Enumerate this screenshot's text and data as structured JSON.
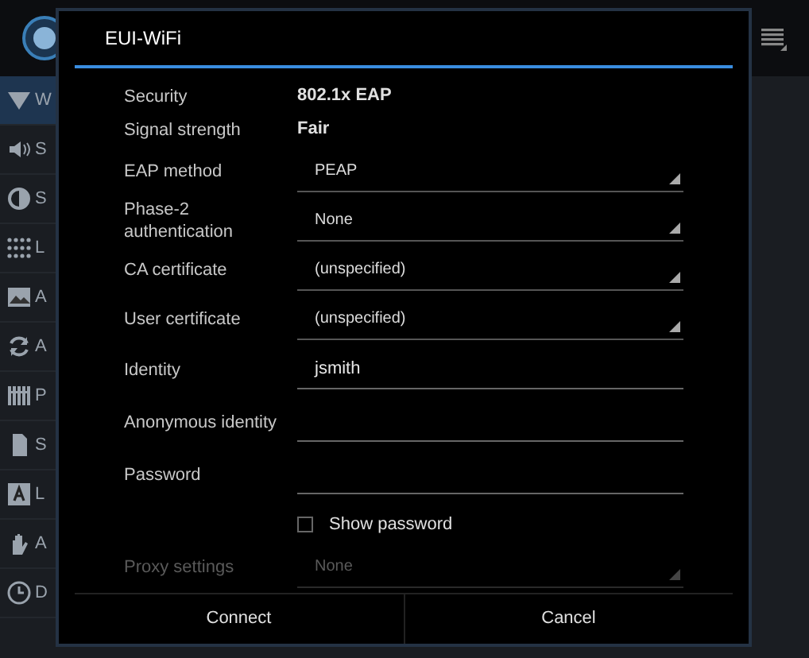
{
  "sidebar": {
    "items": [
      {
        "kind": "wifi",
        "label": "W",
        "selected": true
      },
      {
        "kind": "sound",
        "label": "S",
        "selected": false
      },
      {
        "kind": "brightness",
        "label": "S",
        "selected": false
      },
      {
        "kind": "grid",
        "label": "L",
        "selected": false
      },
      {
        "kind": "image",
        "label": "A",
        "selected": false
      },
      {
        "kind": "sync",
        "label": "A",
        "selected": false
      },
      {
        "kind": "bars",
        "label": "P",
        "selected": false
      },
      {
        "kind": "card",
        "label": "S",
        "selected": false
      },
      {
        "kind": "letter",
        "label": "L",
        "selected": false
      },
      {
        "kind": "hand",
        "label": "A",
        "selected": false
      },
      {
        "kind": "clock",
        "label": "D",
        "selected": false
      }
    ]
  },
  "dialog": {
    "title": "EUI-WiFi",
    "rows": [
      {
        "kind": "info",
        "label": "Security",
        "value": "802.1x EAP"
      },
      {
        "kind": "info",
        "label": "Signal strength",
        "value": "Fair"
      },
      {
        "kind": "spinner",
        "label": "EAP method",
        "value": "PEAP"
      },
      {
        "kind": "spinner",
        "label": "Phase-2 authentication",
        "value": "None"
      },
      {
        "kind": "spinner",
        "label": "CA certificate",
        "value": "(unspecified)"
      },
      {
        "kind": "spinner",
        "label": "User certificate",
        "value": "(unspecified)"
      },
      {
        "kind": "text",
        "label": "Identity",
        "value": "jsmith"
      },
      {
        "kind": "text",
        "label": "Anonymous identity"
      },
      {
        "kind": "password",
        "label": "Password"
      },
      {
        "kind": "checkbox",
        "label": "Show password",
        "checked": false
      },
      {
        "kind": "spinner",
        "label": "Proxy settings",
        "value": "None",
        "faded": true
      }
    ],
    "buttons": [
      "Connect",
      "Cancel"
    ]
  }
}
